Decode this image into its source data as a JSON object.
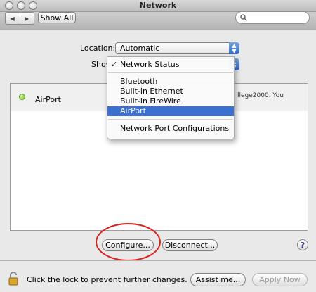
{
  "window": {
    "title": "Network"
  },
  "toolbar": {
    "back_glyph": "◀",
    "forward_glyph": "▶",
    "show_all_label": "Show All",
    "search_value": ""
  },
  "location": {
    "label": "Location:",
    "value": "Automatic"
  },
  "show": {
    "label": "Show"
  },
  "menu": {
    "items": [
      {
        "label": "Network Status",
        "checked": true,
        "check": "✓"
      },
      {
        "label": "Bluetooth"
      },
      {
        "label": "Built-in Ethernet"
      },
      {
        "label": "Built-in FireWire"
      },
      {
        "label": "AirPort",
        "selected": true
      },
      {
        "label": "Network Port Configurations"
      }
    ]
  },
  "status_list": {
    "rows": [
      {
        "name": "AirPort",
        "status_indicator": "green",
        "detail_snippet": "llege2000. You"
      }
    ]
  },
  "buttons": {
    "configure": "Configure...",
    "disconnect": "Disconnect...",
    "help": "?",
    "assist": "Assist me...",
    "apply": "Apply Now"
  },
  "lock": {
    "text": "Click the lock to prevent further changes."
  },
  "colors": {
    "selection": "#3b6fd0",
    "annotation_circle": "#e02020",
    "status_green": "#6fbe2a"
  }
}
